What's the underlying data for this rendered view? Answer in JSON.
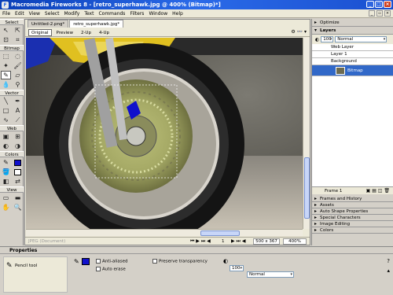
{
  "window": {
    "title": "Macromedia Fireworks 8 - [retro_superhawk.jpg @ 400% (Bitmap)*]"
  },
  "menu": [
    "File",
    "Edit",
    "View",
    "Select",
    "Modify",
    "Text",
    "Commands",
    "Filters",
    "Window",
    "Help"
  ],
  "toolbox": {
    "sections": [
      "Select",
      "Bitmap",
      "Vector",
      "Web",
      "Colors",
      "View"
    ]
  },
  "doc": {
    "tabs": [
      "Untitled-2.png*",
      "retro_superhawk.jpg*"
    ],
    "view_buttons": [
      "Original",
      "Preview",
      "2-Up",
      "4-Up"
    ],
    "status": {
      "left": "JPEG (Document)",
      "frame": "1",
      "size": "500 x 367",
      "zoom": "400%"
    }
  },
  "panels": {
    "optimize": "Optimize",
    "layers": {
      "title": "Layers",
      "opacity": "100",
      "blend": "Normal",
      "rows": [
        "Web Layer",
        "Layer 1",
        "Background",
        "Bitmap"
      ]
    },
    "frame_label": "Frame 1",
    "collapsed": [
      "Frames and History",
      "Assets",
      "Auto Shape Properties",
      "Special Characters",
      "Image Editing",
      "Colors"
    ]
  },
  "props": {
    "title": "Properties",
    "tool": "Pencil tool",
    "anti_aliased": "Anti-aliased",
    "auto_erase": "Auto erase",
    "preserve": "Preserve transparency",
    "opacity": "100",
    "blend": "Normal"
  },
  "colors": {
    "accent": "#3168c8",
    "stroke_swatch": "#1010cc"
  }
}
